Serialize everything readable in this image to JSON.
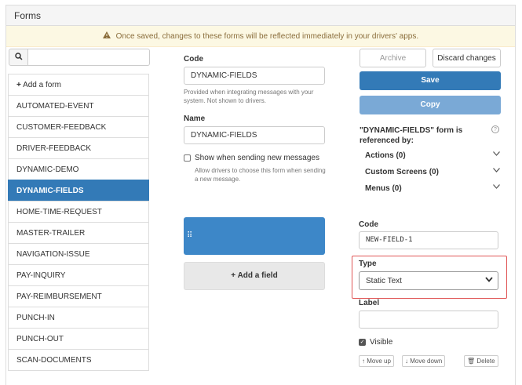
{
  "header": {
    "title": "Forms"
  },
  "banner": {
    "icon": "warning-icon",
    "text": "Once saved, changes to these forms will be reflected immediately in your drivers' apps."
  },
  "search": {
    "icon": "search-icon",
    "placeholder": ""
  },
  "sidebar": {
    "add_label": "Add a form",
    "items": [
      {
        "label": "AUTOMATED-EVENT"
      },
      {
        "label": "CUSTOMER-FEEDBACK"
      },
      {
        "label": "DRIVER-FEEDBACK"
      },
      {
        "label": "DYNAMIC-DEMO"
      },
      {
        "label": "DYNAMIC-FIELDS",
        "active": true
      },
      {
        "label": "HOME-TIME-REQUEST"
      },
      {
        "label": "MASTER-TRAILER"
      },
      {
        "label": "NAVIGATION-ISSUE"
      },
      {
        "label": "PAY-INQUIRY"
      },
      {
        "label": "PAY-REIMBURSEMENT"
      },
      {
        "label": "PUNCH-IN"
      },
      {
        "label": "PUNCH-OUT"
      },
      {
        "label": "SCAN-DOCUMENTS"
      }
    ]
  },
  "form": {
    "code_label": "Code",
    "code_value": "DYNAMIC-FIELDS",
    "code_help": "Provided when integrating messages with your system. Not shown to drivers.",
    "name_label": "Name",
    "name_value": "DYNAMIC-FIELDS",
    "show_label": "Show when sending new messages",
    "show_checked": false,
    "show_help": "Allow drivers to choose this form when sending a new message.",
    "add_field_label": "Add a field"
  },
  "actions": {
    "archive": "Archive",
    "discard": "Discard changes",
    "save": "Save",
    "copy": "Copy"
  },
  "references": {
    "title": "\"DYNAMIC-FIELDS\" form is referenced by:",
    "items": [
      {
        "label": "Actions (0)"
      },
      {
        "label": "Custom Screens (0)"
      },
      {
        "label": "Menus (0)"
      }
    ]
  },
  "field_editor": {
    "code_label": "Code",
    "code_value": "NEW-FIELD-1",
    "type_label": "Type",
    "type_value": "Static Text",
    "label_label": "Label",
    "label_value": "",
    "visible_label": "Visible",
    "visible_checked": true,
    "move_up": "Move up",
    "move_down": "Move down",
    "delete": "Delete"
  },
  "colors": {
    "primary": "#337ab7",
    "warning_bg": "#fcf8e3",
    "highlight_border": "#e05555"
  }
}
